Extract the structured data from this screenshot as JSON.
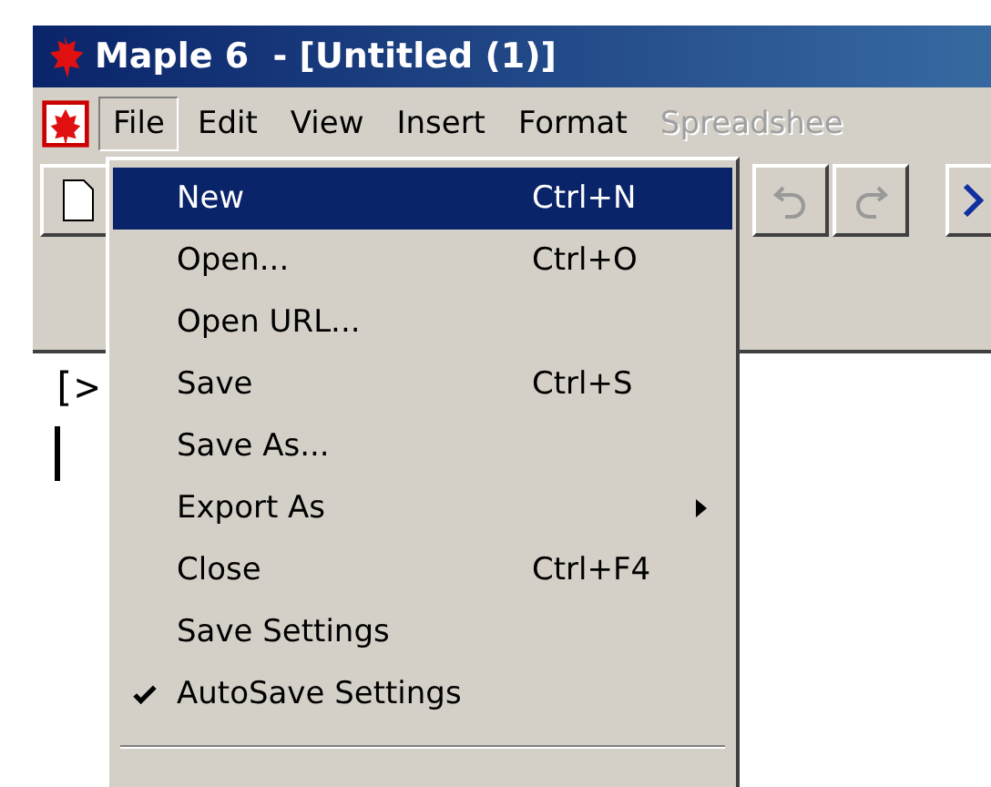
{
  "window": {
    "title": "Maple 6  - [Untitled (1)]"
  },
  "menubar": [
    {
      "label": "File",
      "selected": true,
      "disabled": false
    },
    {
      "label": "Edit",
      "selected": false,
      "disabled": false
    },
    {
      "label": "View",
      "selected": false,
      "disabled": false
    },
    {
      "label": "Insert",
      "selected": false,
      "disabled": false
    },
    {
      "label": "Format",
      "selected": false,
      "disabled": false
    },
    {
      "label": "Spreadshee",
      "selected": false,
      "disabled": true
    }
  ],
  "file_menu": [
    {
      "kind": "item",
      "label": "New",
      "shortcut": "Ctrl+N",
      "selected": true,
      "checked": false
    },
    {
      "kind": "item",
      "label": "Open...",
      "shortcut": "Ctrl+O",
      "selected": false,
      "checked": false
    },
    {
      "kind": "item",
      "label": "Open URL...",
      "selected": false,
      "checked": false
    },
    {
      "kind": "item",
      "label": "Save",
      "shortcut": "Ctrl+S",
      "selected": false,
      "checked": false
    },
    {
      "kind": "item",
      "label": "Save As...",
      "selected": false,
      "checked": false
    },
    {
      "kind": "submenu",
      "label": "Export As",
      "selected": false,
      "checked": false
    },
    {
      "kind": "item",
      "label": "Close",
      "shortcut": "Ctrl+F4",
      "selected": false,
      "checked": false
    },
    {
      "kind": "item",
      "label": "Save Settings",
      "selected": false,
      "checked": false
    },
    {
      "kind": "item",
      "label": "AutoSave Settings",
      "selected": false,
      "checked": true
    },
    {
      "kind": "separator"
    }
  ],
  "worksheet": {
    "prompt": "[>"
  }
}
